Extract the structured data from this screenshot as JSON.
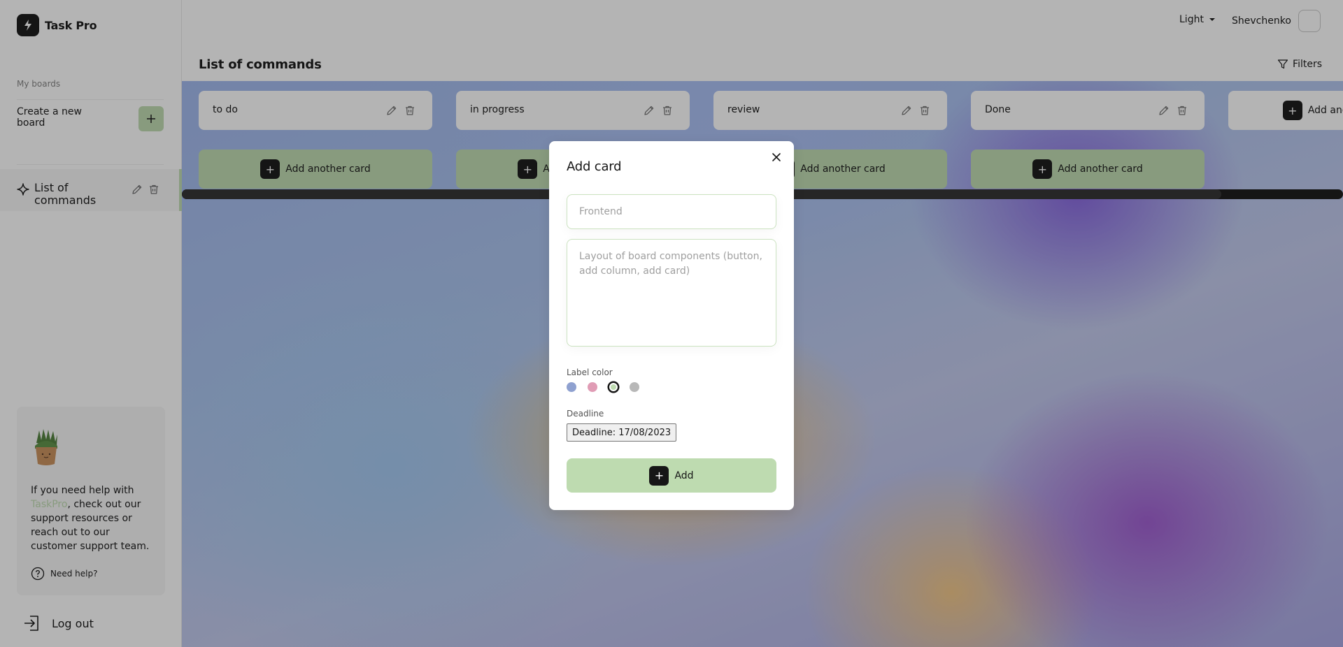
{
  "app": {
    "name": "Task Pro"
  },
  "header": {
    "theme_label": "Light",
    "user_name": "Shevchenko"
  },
  "sidebar": {
    "my_boards_label": "My boards",
    "create_board_label": "Create a new board",
    "boards": [
      {
        "label": "List of commands"
      }
    ],
    "help": {
      "text_before": "If you need help with ",
      "brand": "TaskPro",
      "text_after": ", check out our support resources or reach out to our customer support team.",
      "link_label": "Need help?"
    },
    "logout_label": "Log out"
  },
  "board": {
    "title": "List of commands",
    "filters_label": "Filters",
    "columns": [
      {
        "title": "to do"
      },
      {
        "title": "in progress"
      },
      {
        "title": "review"
      },
      {
        "title": "Done"
      }
    ],
    "add_card_label": "Add another card",
    "add_column_label": "Add another column"
  },
  "modal": {
    "title": "Add card",
    "title_placeholder": "Frontend",
    "description_placeholder": "Layout of board components (button, add column, add card)",
    "label_color_title": "Label color",
    "colors": [
      "#8fa1d0",
      "#e09cb5",
      "#bedbb0",
      "#b8b8b8"
    ],
    "selected_color_index": 2,
    "deadline_title": "Deadline",
    "deadline_value": "Deadline: 17/08/2023",
    "submit_label": "Add"
  }
}
